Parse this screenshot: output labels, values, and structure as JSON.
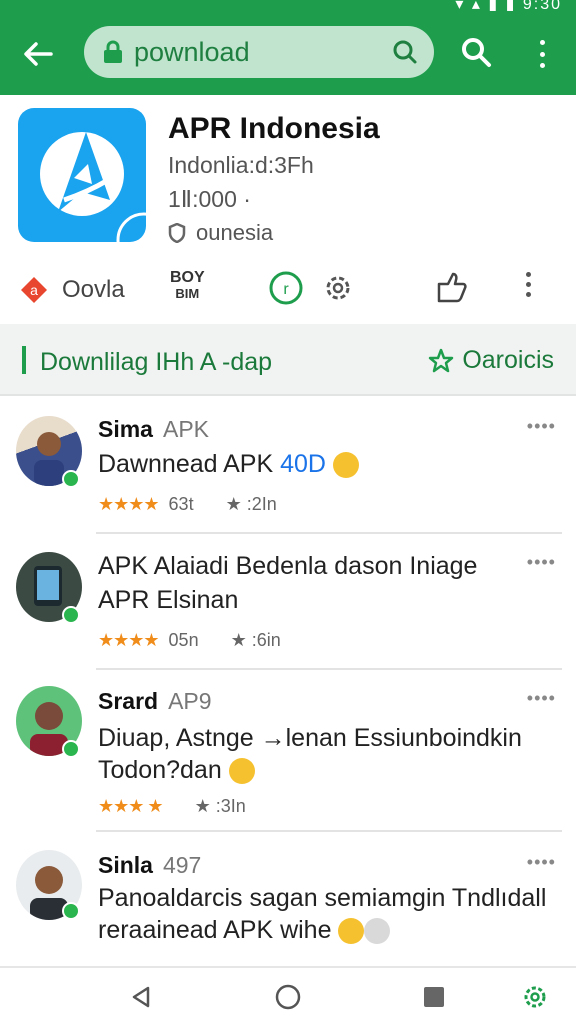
{
  "status_bar": {
    "text": "▾ ▴ ▮ ▮ 9:30"
  },
  "search": {
    "query": "pownload"
  },
  "app": {
    "name": "APR Indonesia",
    "subtitle": "Indonlia:d:3Fh",
    "downloads": "1Ⅱ:000 ·",
    "tag": "ounesia"
  },
  "actions": {
    "first_label": "Oovla",
    "boy_line1": "BOY",
    "boy_line2": "BIM"
  },
  "section": {
    "title": "Downlilag IHh  A -dap",
    "right_label": "Oaroicis"
  },
  "reviews": [
    {
      "name": "Sima",
      "tag": "APK",
      "line1": "Dawnnead APK ",
      "line1_accent": "40D",
      "line2": "",
      "line2_green": "",
      "stars_text": "★★★★",
      "count": "63t",
      "time": "★ :2In",
      "emoji": "yes"
    },
    {
      "name": "",
      "tag": "",
      "line1": "APK  Alaiadi Bedenla dason Iniage",
      "line1_accent": "",
      "line2": "",
      "line2_green": "APR Elsinan",
      "stars_text": "★★★★",
      "count": "05n",
      "time": "★ :6in"
    },
    {
      "name": "Srard",
      "tag": "AP9",
      "line1": "Diuap, Astnge →lenan Essiunboindkin",
      "line1_accent": "",
      "line2": "Todon?dan",
      "line2_green": "",
      "stars_text": "★★★ ★",
      "count": "",
      "time": "★ :3In"
    },
    {
      "name": "Sinla",
      "tag": "497",
      "line1": "Panoaldarcis sagan semiamgin Tndlıdall",
      "line1_accent": "",
      "line2": "reraainead APK wihe",
      "line2_green": "",
      "stars_text": "",
      "count": "",
      "time": ""
    }
  ],
  "colors": {
    "brand_green": "#1e9e4d",
    "app_blue": "#1aa3ef",
    "star_orange": "#f08c1a",
    "link_blue": "#1a73e8"
  },
  "icons": [
    "back-arrow-icon",
    "lock-icon",
    "search-icon",
    "more-vert-icon",
    "app-logo-icon",
    "shield-icon",
    "google-play-icon",
    "refresh-circle-icon",
    "gear-icon",
    "thumb-icon",
    "star-outline-icon",
    "back-triangle-icon",
    "home-circle-icon",
    "recents-square-icon",
    "settings-gear-icon"
  ]
}
